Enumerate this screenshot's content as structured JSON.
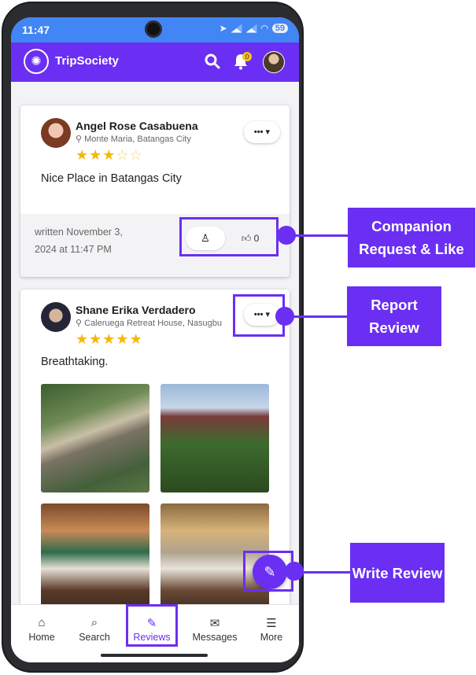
{
  "status_bar": {
    "time": "11:47",
    "battery": "59"
  },
  "app_bar": {
    "brand": "TripSociety",
    "notification_count": "0"
  },
  "reviews": [
    {
      "author": "Angel Rose Casabuena",
      "location": "Monte Maria, Batangas City",
      "rating": 3,
      "rating_max": 5,
      "text": "Nice Place in Batangas City",
      "written": "written November 3, 2024 at 11:47 PM",
      "likes": "0"
    },
    {
      "author": "Shane Erika Verdadero",
      "location": "Caleruega Retreat House, Nasugbu",
      "rating": 5,
      "rating_max": 5,
      "text": "Breathtaking."
    }
  ],
  "bottom_nav": [
    {
      "label": "Home",
      "icon": "home-icon",
      "active": false
    },
    {
      "label": "Search",
      "icon": "search-icon",
      "active": false
    },
    {
      "label": "Reviews",
      "icon": "edit-icon",
      "active": true
    },
    {
      "label": "Messages",
      "icon": "envelope-icon",
      "active": false
    },
    {
      "label": "More",
      "icon": "menu-icon",
      "active": false
    }
  ],
  "callouts": {
    "companion_like": "Companion Request & Like",
    "report_review": "Report Review",
    "write_review": "Write Review"
  },
  "colors": {
    "primary": "#6a2ff2",
    "status_bar": "#4285f4",
    "star": "#f5b800"
  }
}
